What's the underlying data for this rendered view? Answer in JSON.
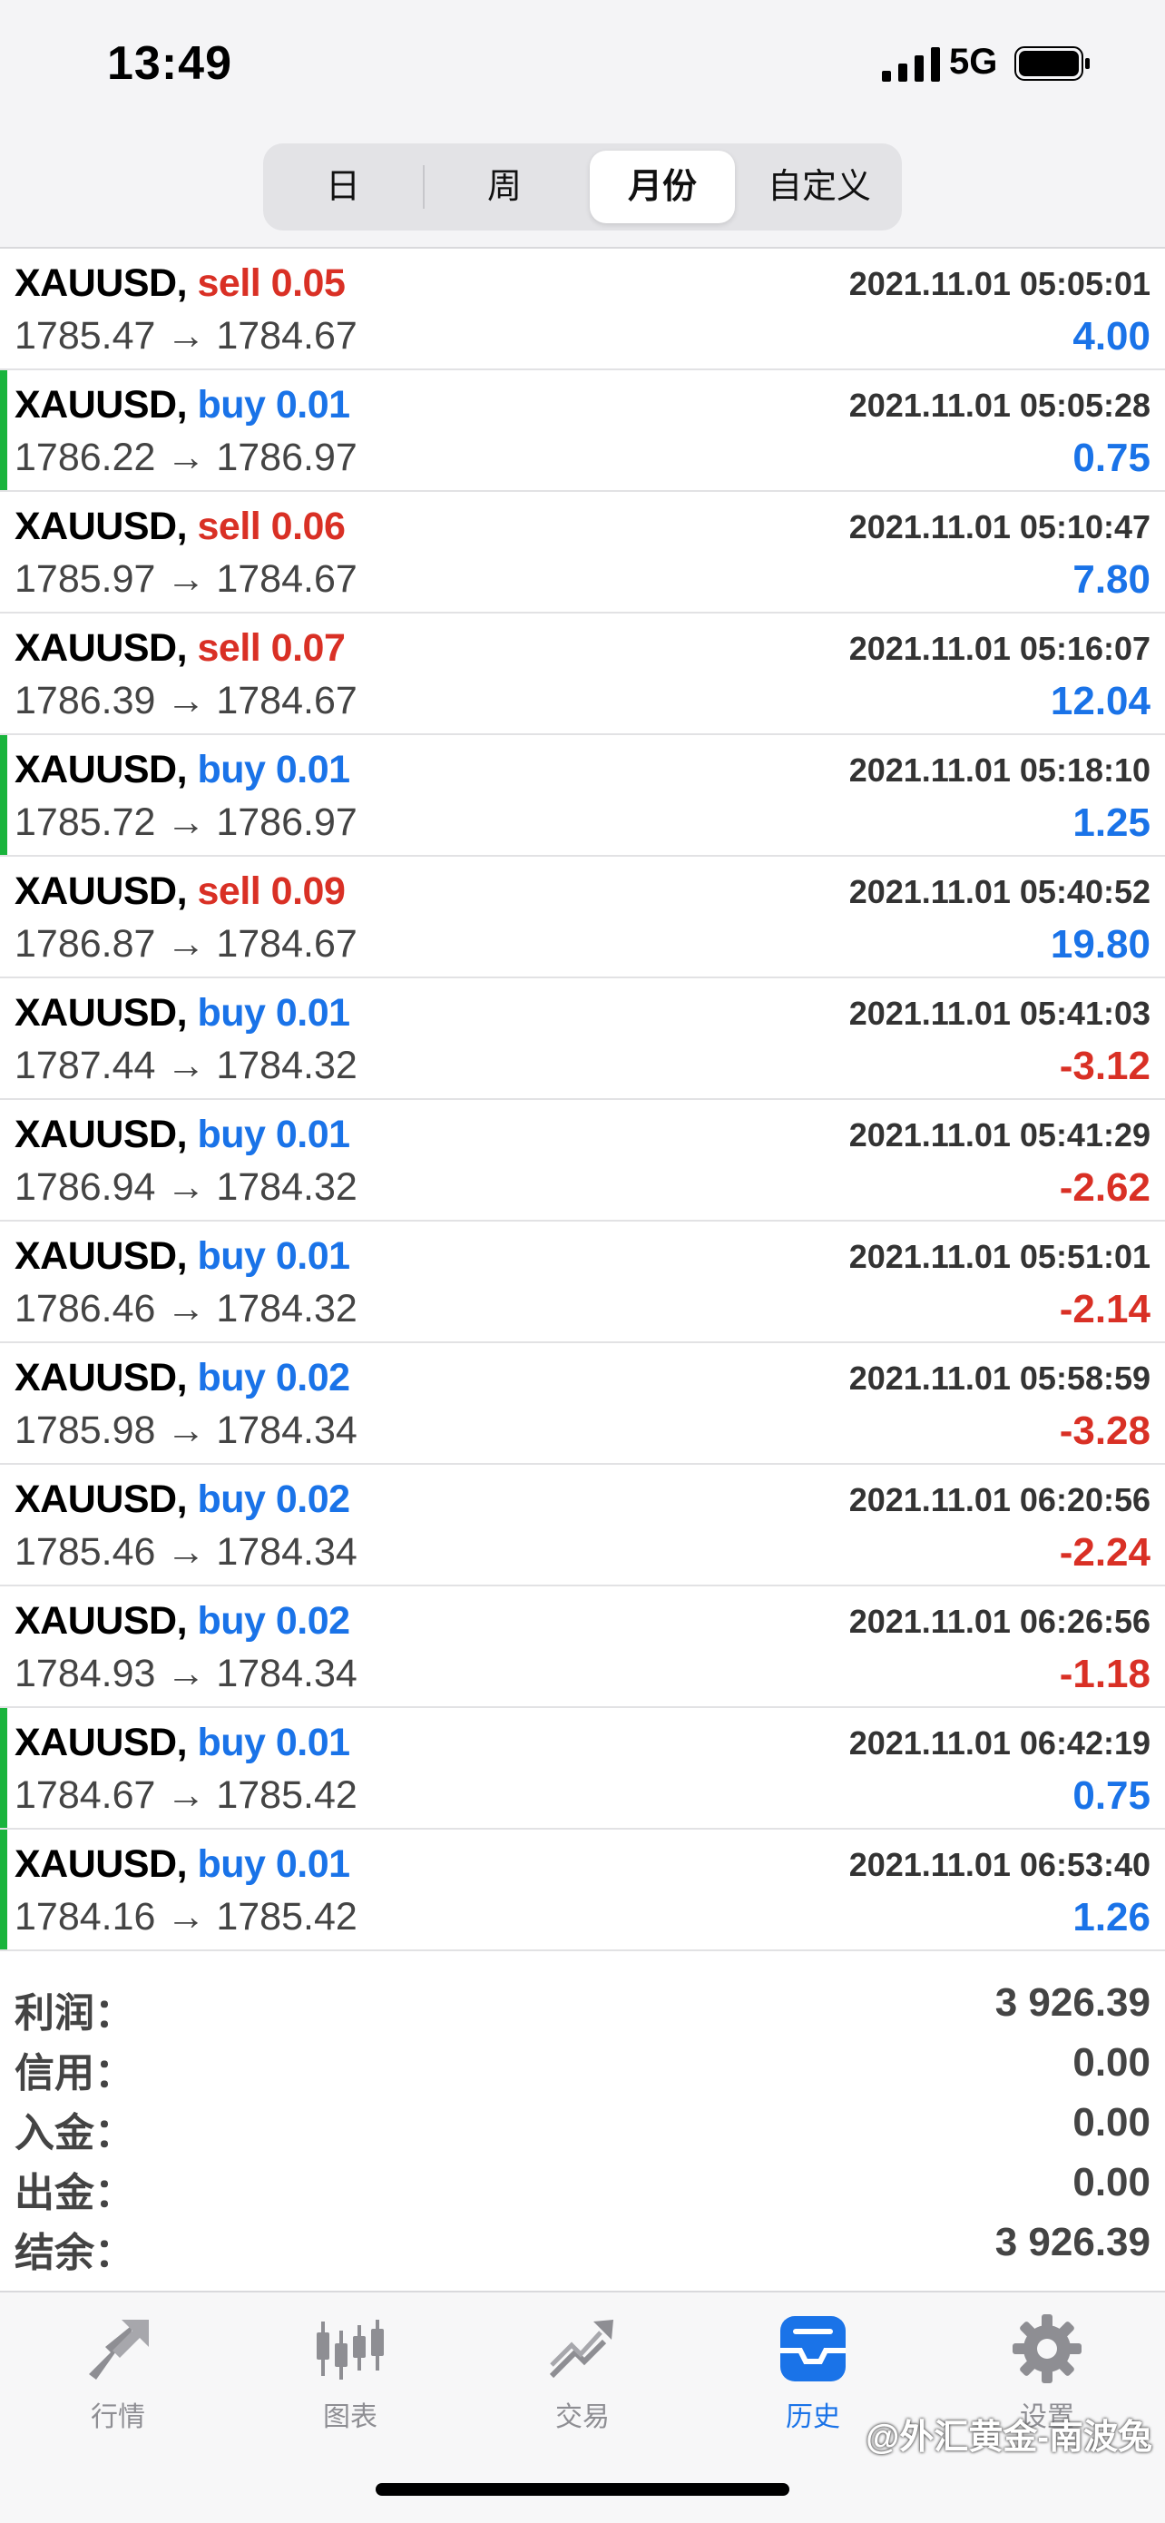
{
  "status_bar": {
    "time": "13:49",
    "network": "5G"
  },
  "segments": [
    {
      "label": "日",
      "active": false
    },
    {
      "label": "周",
      "active": false
    },
    {
      "label": "月份",
      "active": true
    },
    {
      "label": "自定义",
      "active": false
    }
  ],
  "trades": [
    {
      "symbol": "XAUUSD,",
      "side": "sell",
      "volume": "0.05",
      "time": "2021.11.01 05:05:01",
      "open": "1785.47",
      "close": "1784.67",
      "profit": "4.00",
      "win_marker": false
    },
    {
      "symbol": "XAUUSD,",
      "side": "buy",
      "volume": "0.01",
      "time": "2021.11.01 05:05:28",
      "open": "1786.22",
      "close": "1786.97",
      "profit": "0.75",
      "win_marker": true
    },
    {
      "symbol": "XAUUSD,",
      "side": "sell",
      "volume": "0.06",
      "time": "2021.11.01 05:10:47",
      "open": "1785.97",
      "close": "1784.67",
      "profit": "7.80",
      "win_marker": false
    },
    {
      "symbol": "XAUUSD,",
      "side": "sell",
      "volume": "0.07",
      "time": "2021.11.01 05:16:07",
      "open": "1786.39",
      "close": "1784.67",
      "profit": "12.04",
      "win_marker": false
    },
    {
      "symbol": "XAUUSD,",
      "side": "buy",
      "volume": "0.01",
      "time": "2021.11.01 05:18:10",
      "open": "1785.72",
      "close": "1786.97",
      "profit": "1.25",
      "win_marker": true
    },
    {
      "symbol": "XAUUSD,",
      "side": "sell",
      "volume": "0.09",
      "time": "2021.11.01 05:40:52",
      "open": "1786.87",
      "close": "1784.67",
      "profit": "19.80",
      "win_marker": false
    },
    {
      "symbol": "XAUUSD,",
      "side": "buy",
      "volume": "0.01",
      "time": "2021.11.01 05:41:03",
      "open": "1787.44",
      "close": "1784.32",
      "profit": "-3.12",
      "win_marker": false
    },
    {
      "symbol": "XAUUSD,",
      "side": "buy",
      "volume": "0.01",
      "time": "2021.11.01 05:41:29",
      "open": "1786.94",
      "close": "1784.32",
      "profit": "-2.62",
      "win_marker": false
    },
    {
      "symbol": "XAUUSD,",
      "side": "buy",
      "volume": "0.01",
      "time": "2021.11.01 05:51:01",
      "open": "1786.46",
      "close": "1784.32",
      "profit": "-2.14",
      "win_marker": false
    },
    {
      "symbol": "XAUUSD,",
      "side": "buy",
      "volume": "0.02",
      "time": "2021.11.01 05:58:59",
      "open": "1785.98",
      "close": "1784.34",
      "profit": "-3.28",
      "win_marker": false
    },
    {
      "symbol": "XAUUSD,",
      "side": "buy",
      "volume": "0.02",
      "time": "2021.11.01 06:20:56",
      "open": "1785.46",
      "close": "1784.34",
      "profit": "-2.24",
      "win_marker": false
    },
    {
      "symbol": "XAUUSD,",
      "side": "buy",
      "volume": "0.02",
      "time": "2021.11.01 06:26:56",
      "open": "1784.93",
      "close": "1784.34",
      "profit": "-1.18",
      "win_marker": false
    },
    {
      "symbol": "XAUUSD,",
      "side": "buy",
      "volume": "0.01",
      "time": "2021.11.01 06:42:19",
      "open": "1784.67",
      "close": "1785.42",
      "profit": "0.75",
      "win_marker": true
    },
    {
      "symbol": "XAUUSD,",
      "side": "buy",
      "volume": "0.01",
      "time": "2021.11.01 06:53:40",
      "open": "1784.16",
      "close": "1785.42",
      "profit": "1.26",
      "win_marker": true
    }
  ],
  "arrow": "→",
  "summary": [
    {
      "label": "利润：",
      "value": "3 926.39"
    },
    {
      "label": "信用：",
      "value": "0.00"
    },
    {
      "label": "入金：",
      "value": "0.00"
    },
    {
      "label": "出金：",
      "value": "0.00"
    },
    {
      "label": "结余：",
      "value": "3 926.39"
    }
  ],
  "tabs": [
    {
      "label": "行情",
      "icon": "quotes-arrows-icon",
      "active": false
    },
    {
      "label": "图表",
      "icon": "candlestick-chart-icon",
      "active": false
    },
    {
      "label": "交易",
      "icon": "trade-trend-icon",
      "active": false
    },
    {
      "label": "历史",
      "icon": "history-inbox-icon",
      "active": true
    },
    {
      "label": "设置",
      "icon": "gear-icon",
      "active": false
    }
  ],
  "watermark": "@外汇黄金-南波兔",
  "colors": {
    "sell": "#d93025",
    "buy": "#1a73e8",
    "negative": "#d93025",
    "positive": "#1a73e8",
    "win_marker": "#19b43c",
    "active_tab": "#1a73e8"
  }
}
